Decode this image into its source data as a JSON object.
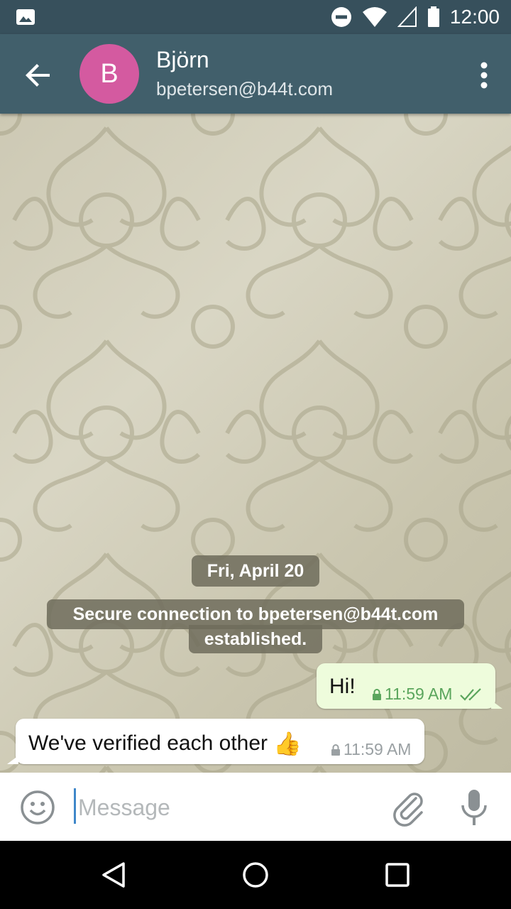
{
  "status_bar": {
    "time": "12:00"
  },
  "toolbar": {
    "avatar_letter": "B",
    "title": "Björn",
    "subtitle": "bpetersen@b44t.com",
    "avatar_color": "#d45aa0",
    "bar_color": "#415f6b"
  },
  "chat": {
    "date_label": "Fri, April 20",
    "system_line1": "Secure connection to bpetersen@b44t.com",
    "system_line2": "established.",
    "messages": [
      {
        "direction": "outgoing",
        "text": "Hi!",
        "time": "11:59 AM",
        "status_icon": "double-check-icon",
        "lock_icon": "lock-icon"
      },
      {
        "direction": "incoming",
        "text": "We've verified each other",
        "emoji": "👍",
        "time": "11:59 AM",
        "lock_icon": "lock-icon"
      }
    ]
  },
  "composer": {
    "placeholder": "Message",
    "value": ""
  },
  "icons": {
    "back": "arrow-back-icon",
    "menu": "more-vert-icon",
    "emoji": "emoji-icon",
    "attach": "paperclip-icon",
    "mic": "microphone-icon"
  }
}
